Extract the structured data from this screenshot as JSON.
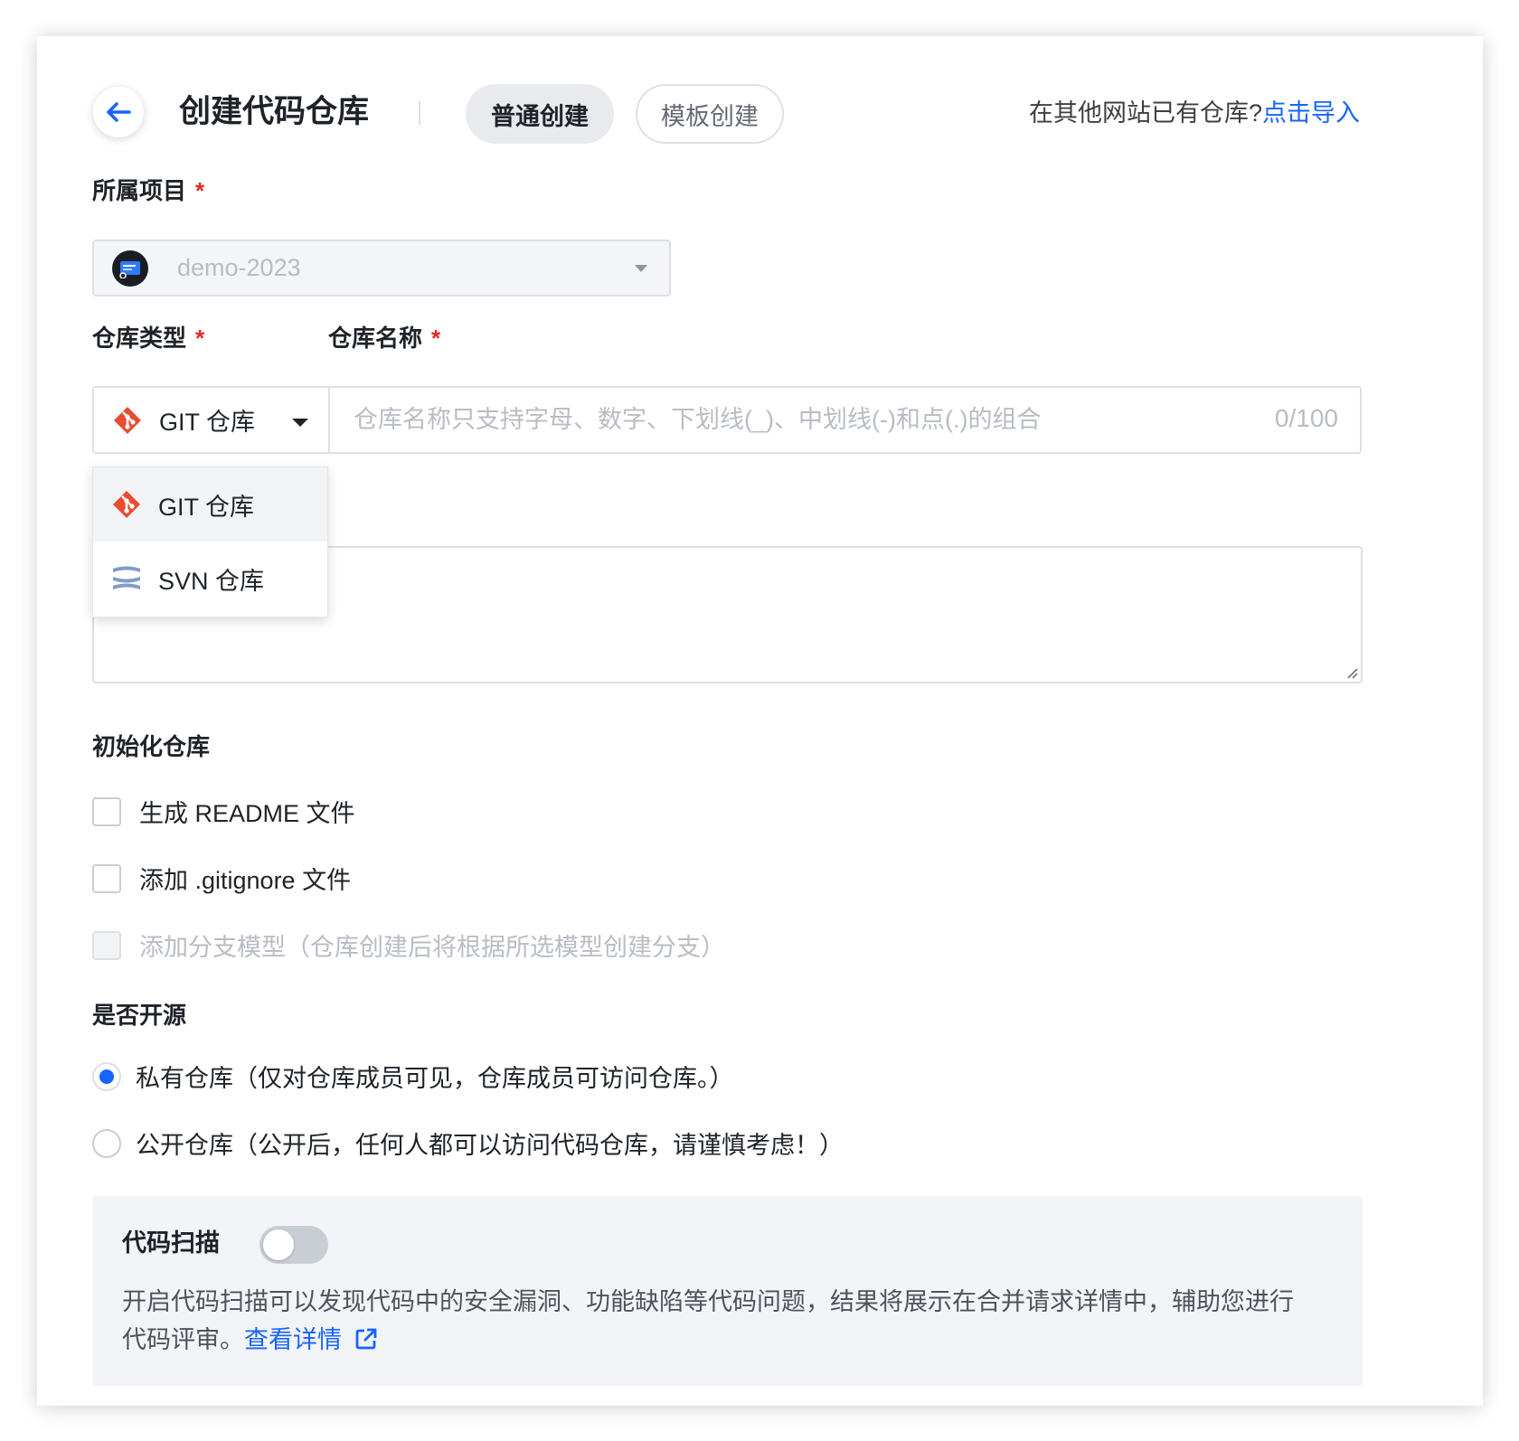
{
  "header": {
    "title": "创建代码仓库",
    "tabs": [
      {
        "label": "普通创建",
        "active": true
      },
      {
        "label": "模板创建",
        "active": false
      }
    ],
    "import_prompt": "在其他网站已有仓库?",
    "import_link": "点击导入",
    "icons": {
      "back": "arrow-left-icon"
    }
  },
  "project": {
    "label": "所属项目",
    "required": "*",
    "value": "demo-2023",
    "icon": "project-avatar-icon"
  },
  "repo_type": {
    "label": "仓库类型",
    "required": "*",
    "value": "GIT 仓库",
    "options": [
      {
        "label": "GIT 仓库",
        "icon": "git-icon",
        "selected": true
      },
      {
        "label": "SVN 仓库",
        "icon": "svn-icon",
        "selected": false
      }
    ]
  },
  "repo_name": {
    "label": "仓库名称",
    "required": "*",
    "placeholder": "仓库名称只支持字母、数字、下划线(_)、中划线(-)和点(.)的组合",
    "value": "",
    "counter": "0/100"
  },
  "description": {
    "value": ""
  },
  "init": {
    "label": "初始化仓库",
    "options": [
      {
        "label": "生成 README 文件",
        "checked": false,
        "disabled": false
      },
      {
        "label": "添加 .gitignore 文件",
        "checked": false,
        "disabled": false
      },
      {
        "label": "添加分支模型（仓库创建后将根据所选模型创建分支）",
        "checked": false,
        "disabled": true
      }
    ]
  },
  "visibility": {
    "label": "是否开源",
    "options": [
      {
        "label": "私有仓库（仅对仓库成员可见，仓库成员可访问仓库。）",
        "checked": true
      },
      {
        "label": "公开仓库（公开后，任何人都可以访问代码仓库，请谨慎考虑！）",
        "checked": false
      }
    ]
  },
  "scan": {
    "title": "代码扫描",
    "enabled": false,
    "description": "开启代码扫描可以发现代码中的安全漏洞、功能缺陷等代码问题，结果将展示在合并请求详情中，辅助您进行代码评审。",
    "link": "查看详情",
    "icon": "external-link-icon"
  },
  "colors": {
    "accent": "#1664ff",
    "required": "#e02828",
    "git": "#e84d31",
    "svn": "#809cc9"
  }
}
